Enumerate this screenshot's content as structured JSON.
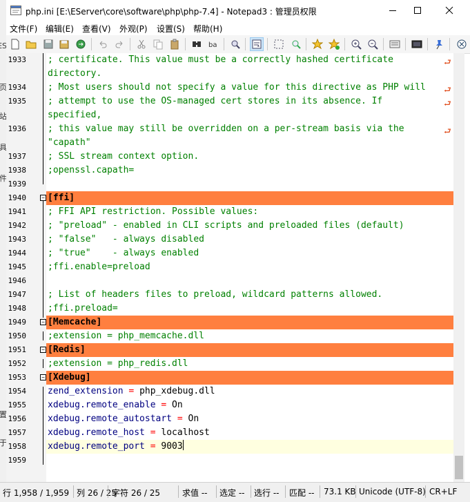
{
  "window": {
    "title": "php.ini [E:\\EServer\\core\\software\\php\\php-7.4] - Notepad3 : 管理员权限",
    "minimize": "—",
    "maximize": "☐",
    "close": "✕"
  },
  "left_strip": [
    "ES",
    "页",
    "站",
    "具",
    "件",
    "置",
    "于"
  ],
  "menu": [
    "文件(F)",
    "编辑(E)",
    "查看(V)",
    "外观(P)",
    "设置(S)",
    "帮助(H)"
  ],
  "toolbar_icons": [
    "new-file-icon",
    "open-folder-icon",
    "save-icon",
    "save-as-icon",
    "browse-icon",
    "undo-icon",
    "redo-icon",
    "cut-icon",
    "copy-icon",
    "paste-icon",
    "find-icon",
    "replace-icon",
    "find-in-files-icon",
    "word-wrap-icon",
    "select-icon",
    "zoom-find-icon",
    "favorite-icon",
    "add-favorite-icon",
    "zoom-in-icon",
    "zoom-out-icon",
    "settings-icon",
    "screen-icon",
    "pin-icon",
    "exit-icon"
  ],
  "editor": {
    "lines": [
      {
        "num": "1933",
        "text": "; certificate. This value must be a correctly hashed certificate",
        "kind": "comment",
        "wrap": true
      },
      {
        "num": "",
        "text": "directory.",
        "kind": "comment"
      },
      {
        "num": "1934",
        "text": "; Most users should not specify a value for this directive as PHP will",
        "kind": "comment",
        "wrap": true
      },
      {
        "num": "1935",
        "text": "; attempt to use the OS-managed cert stores in its absence. If",
        "kind": "comment",
        "wrap": true
      },
      {
        "num": "",
        "text": "specified,",
        "kind": "comment"
      },
      {
        "num": "1936",
        "text": "; this value may still be overridden on a per-stream basis via the",
        "kind": "comment",
        "wrap": true
      },
      {
        "num": "",
        "text": "\"capath\"",
        "kind": "comment"
      },
      {
        "num": "1937",
        "text": "; SSL stream context option.",
        "kind": "comment"
      },
      {
        "num": "1938",
        "text": ";openssl.capath=",
        "kind": "comment"
      },
      {
        "num": "1939",
        "text": "",
        "kind": "blank"
      },
      {
        "num": "1940",
        "text": "[ffi]",
        "kind": "section"
      },
      {
        "num": "1941",
        "text": "; FFI API restriction. Possible values:",
        "kind": "comment"
      },
      {
        "num": "1942",
        "text": "; \"preload\" - enabled in CLI scripts and preloaded files (default)",
        "kind": "comment"
      },
      {
        "num": "1943",
        "text": "; \"false\"   - always disabled",
        "kind": "comment"
      },
      {
        "num": "1944",
        "text": "; \"true\"    - always enabled",
        "kind": "comment"
      },
      {
        "num": "1945",
        "text": ";ffi.enable=preload",
        "kind": "comment"
      },
      {
        "num": "1946",
        "text": "",
        "kind": "blank"
      },
      {
        "num": "1947",
        "text": "; List of headers files to preload, wildcard patterns allowed.",
        "kind": "comment"
      },
      {
        "num": "1948",
        "text": ";ffi.preload=",
        "kind": "comment"
      },
      {
        "num": "1949",
        "text": "[Memcache]",
        "kind": "section"
      },
      {
        "num": "1950",
        "text": ";extension = php_memcache.dll",
        "kind": "comment"
      },
      {
        "num": "1951",
        "text": "[Redis]",
        "kind": "section"
      },
      {
        "num": "1952",
        "text": ";extension = php_redis.dll",
        "kind": "comment"
      },
      {
        "num": "1953",
        "text": "[Xdebug]",
        "kind": "section"
      },
      {
        "num": "1954",
        "key": "zend_extension",
        "value": "php_xdebug.dll",
        "kind": "kv"
      },
      {
        "num": "1955",
        "key": "xdebug.remote_enable",
        "value": "On",
        "kind": "kv"
      },
      {
        "num": "1956",
        "key": "xdebug.remote_autostart",
        "value": "On",
        "kind": "kv"
      },
      {
        "num": "1957",
        "key": "xdebug.remote_host",
        "value": "localhost",
        "kind": "kv"
      },
      {
        "num": "1958",
        "key": "xdebug.remote_port",
        "value": "9003",
        "kind": "kv",
        "current": true
      },
      {
        "num": "1959",
        "text": "",
        "kind": "blank"
      }
    ]
  },
  "status": [
    "行  1,958 / 1,959",
    "列   26 / 25",
    "字符  26 / 25",
    "求值  --",
    "选定  --",
    "选行  --",
    "匹配  --",
    "73.1 KB",
    "Unicode (UTF-8)",
    "CR+LF"
  ],
  "colors": {
    "section_band": "#ff7f3f",
    "comment": "#008000",
    "key": "#000080",
    "operator": "#ff0000",
    "current_line": "#ffffe0",
    "wrap_marker": "#e05020"
  }
}
